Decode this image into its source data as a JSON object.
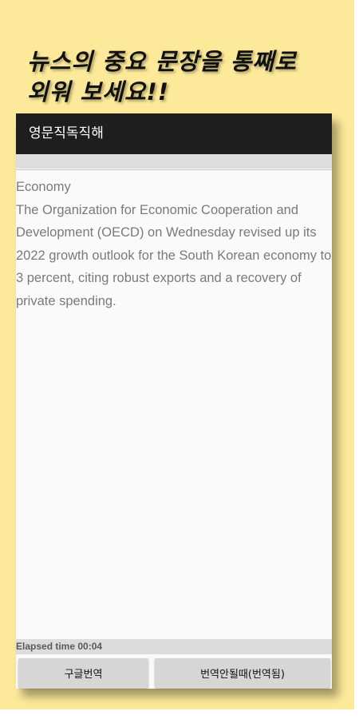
{
  "promo": {
    "headline": "뉴스의 중요 문장을 통째로\n외워 보세요!!",
    "background_color": "#fde99a"
  },
  "app": {
    "title": "영문직독직해",
    "app_bar_color": "#1e1e1e"
  },
  "article": {
    "category": "Economy",
    "body": "The Organization for Economic Cooperation and Development (OECD) on Wednesday revised up its 2022 growth outlook for the South Korean economy to 3 percent, citing robust exports and a recovery of private spending."
  },
  "status": {
    "elapsed": "Elapsed time 00:04"
  },
  "buttons": {
    "google_translate": "구글번역",
    "when_untranslated": "번역안될때(번역됨)"
  }
}
